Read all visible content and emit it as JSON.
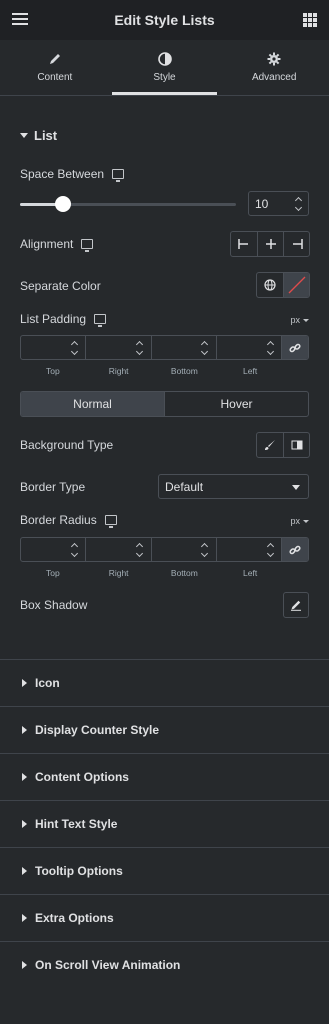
{
  "header": {
    "title": "Edit Style Lists",
    "menu_icon": "hamburger-icon",
    "apps_icon": "grid-icon"
  },
  "tabs": [
    {
      "label": "Content",
      "icon": "pencil-icon"
    },
    {
      "label": "Style",
      "icon": "half-circle-icon"
    },
    {
      "label": "Advanced",
      "icon": "gear-icon"
    }
  ],
  "active_tab": "Style",
  "list_section": {
    "title": "List",
    "space_between": {
      "label": "Space Between",
      "value": "10",
      "fraction": 0.2
    },
    "alignment": {
      "label": "Alignment"
    },
    "separate_color": {
      "label": "Separate Color"
    },
    "list_padding": {
      "label": "List Padding",
      "unit": "px",
      "sides": [
        "Top",
        "Right",
        "Bottom",
        "Left"
      ]
    },
    "state_tabs": [
      "Normal",
      "Hover"
    ],
    "active_state": "Normal",
    "background_type": {
      "label": "Background Type"
    },
    "border_type": {
      "label": "Border Type",
      "value": "Default"
    },
    "border_radius": {
      "label": "Border Radius",
      "unit": "px",
      "sides": [
        "Top",
        "Right",
        "Bottom",
        "Left"
      ]
    },
    "box_shadow": {
      "label": "Box Shadow"
    }
  },
  "collapsed_sections": [
    "Icon",
    "Display Counter Style",
    "Content Options",
    "Hint Text Style",
    "Tooltip Options",
    "Extra Options",
    "On Scroll View Animation"
  ],
  "colors": {
    "panel": "#26292c",
    "header": "#1f2124",
    "border": "#4a4f56",
    "accent_none": "#e04b4b"
  }
}
